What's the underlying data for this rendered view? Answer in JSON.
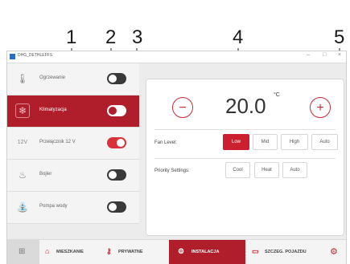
{
  "callouts": [
    "1",
    "2",
    "3",
    "4",
    "5"
  ],
  "window": {
    "title": "DHG_DETHLEFFS",
    "minimize": "–",
    "maximize": "□",
    "close": "×"
  },
  "sidebar": {
    "items": [
      {
        "label": "Ogrzewanie",
        "icon": "thermometer-icon",
        "toggle": "off"
      },
      {
        "label": "Klimatyzacja",
        "icon": "snowflake-icon",
        "toggle": "on"
      },
      {
        "label": "Przełącznik 12 V",
        "icon": "12v-icon",
        "icon_text": "12V",
        "toggle": "on"
      },
      {
        "label": "Bojler",
        "icon": "flame-icon",
        "toggle": "off"
      },
      {
        "label": "Pompa wody",
        "icon": "water-pump-icon",
        "toggle": "off"
      }
    ]
  },
  "climate": {
    "temperature": "20.0",
    "unit": "°C",
    "minus": "−",
    "plus": "+",
    "fan_level_label": "Fan Level:",
    "fan_options": [
      "Low",
      "Mid",
      "High",
      "Auto"
    ],
    "fan_selected": "Low",
    "priority_label": "Priority Settings:",
    "priority_options": [
      "Cool",
      "Heat",
      "Auto"
    ]
  },
  "bottom_nav": {
    "items": [
      {
        "label": "MIESZKANIE",
        "icon": "living-area-icon"
      },
      {
        "label": "PRYWATNE",
        "icon": "private-icon"
      },
      {
        "label": "INSTALACJA",
        "icon": "installation-icon",
        "active": true
      },
      {
        "label": "SZCZEG. POJAZDU",
        "icon": "vehicle-details-icon"
      }
    ],
    "settings_icon": "gear-icon"
  },
  "colors": {
    "accent": "#b01e2c",
    "toggle_on": "#d8323c",
    "toggle_off": "#3a3a3a"
  }
}
